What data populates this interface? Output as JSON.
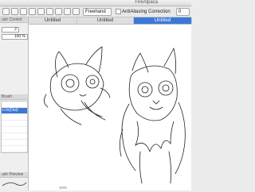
{
  "window": {
    "title": "FireAlpaca"
  },
  "toolbar": {
    "brush_mode": "Freehand",
    "antialiasing_label": "AntiAliasing",
    "correction_label": "Correction",
    "correction_value": "0"
  },
  "tabs": [
    {
      "label": "Untitled",
      "active": false
    },
    {
      "label": "Untitled",
      "active": false
    },
    {
      "label": "Untitled",
      "active": true
    }
  ],
  "left_panel": {
    "brush_control_header": "ush Control",
    "size_value": "2",
    "opacity_value": "100 %",
    "brush_header": "Brush",
    "brush_items": [
      {
        "label": "",
        "selected": false
      },
      {
        "label": "n In(Out)",
        "selected": true
      },
      {
        "label": "",
        "selected": false
      },
      {
        "label": "",
        "selected": false
      },
      {
        "label": "",
        "selected": false
      },
      {
        "label": "",
        "selected": false
      },
      {
        "label": "",
        "selected": false
      },
      {
        "label": "",
        "selected": false
      }
    ],
    "preview_header": "ush Preview"
  },
  "colors": {
    "accent": "#3b78d8"
  }
}
